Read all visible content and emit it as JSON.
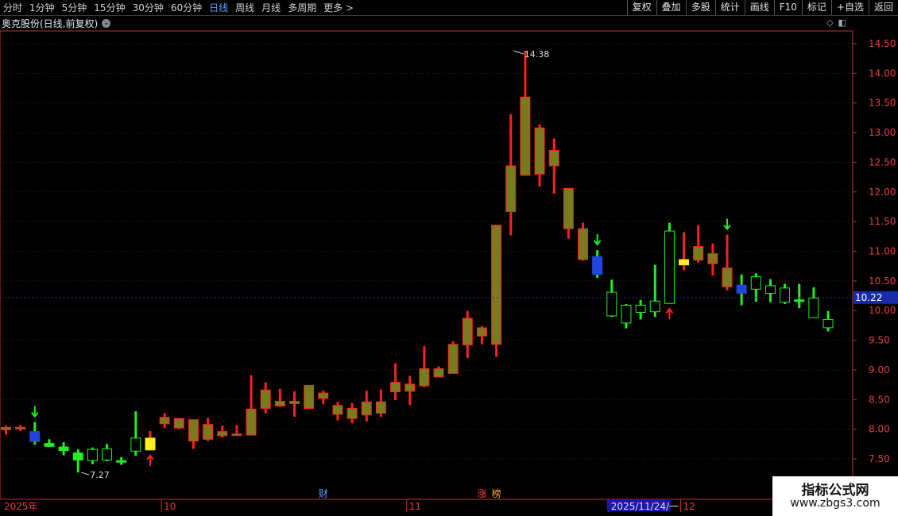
{
  "toolbar": {
    "periods": [
      "分时",
      "1分钟",
      "5分钟",
      "15分钟",
      "30分钟",
      "60分钟",
      "日线",
      "周线",
      "月线",
      "多周期",
      "更多 >"
    ],
    "active_period": "日线",
    "right_buttons": [
      "复权",
      "叠加",
      "多股",
      "统计",
      "画线",
      "F10",
      "标记",
      "+自选",
      "返回"
    ]
  },
  "title": "奥克股份(日线,前复权)",
  "colors": {
    "up": "#ff2020",
    "down": "#22ee22",
    "olive": "#7a7a1e",
    "blue": "#2244dd",
    "yellow": "#ffee22",
    "axis": "#c03030",
    "grid": "#5a1a1a"
  },
  "chart_data": {
    "type": "candlestick",
    "y_ticks": [
      "14.50",
      "14.00",
      "13.50",
      "13.00",
      "12.50",
      "12.00",
      "11.50",
      "11.00",
      "10.50",
      "10.00",
      "9.50",
      "9.00",
      "8.50",
      "8.00",
      "7.50"
    ],
    "ylim": [
      7.3,
      14.6
    ],
    "current_price": "10.22",
    "high_label": "14.38",
    "low_label": "7.27",
    "x_labels": [
      {
        "text": "2025年",
        "index": 0
      },
      {
        "text": "10",
        "index": 11
      },
      {
        "text": "11",
        "index": 28
      },
      {
        "text": "2025/11/24/一",
        "index": 42
      },
      {
        "text": "12",
        "index": 47
      }
    ],
    "event_tags": [
      {
        "text": "财",
        "index": 22,
        "color": "#5aa0ff"
      },
      {
        "text": "涨",
        "index": 33,
        "color": "#ff4040"
      },
      {
        "text": "榜",
        "index": 34,
        "color": "#ffaa40"
      }
    ],
    "candles": [
      {
        "o": 8.03,
        "h": 8.06,
        "l": 7.91,
        "c": 7.99,
        "k": "olive"
      },
      {
        "o": 8.01,
        "h": 8.07,
        "l": 7.97,
        "c": 8.03,
        "k": "olive"
      },
      {
        "o": 7.96,
        "h": 8.12,
        "l": 7.74,
        "c": 7.79,
        "k": "blue"
      },
      {
        "o": 7.76,
        "h": 7.83,
        "l": 7.7,
        "c": 7.71,
        "k": "down"
      },
      {
        "o": 7.7,
        "h": 7.78,
        "l": 7.56,
        "c": 7.64,
        "k": "down"
      },
      {
        "o": 7.6,
        "h": 7.66,
        "l": 7.27,
        "c": 7.48,
        "k": "down"
      },
      {
        "o": 7.47,
        "h": 7.69,
        "l": 7.41,
        "c": 7.66,
        "k": "downhollow"
      },
      {
        "o": 7.67,
        "h": 7.75,
        "l": 7.46,
        "c": 7.48,
        "k": "downhollow"
      },
      {
        "o": 7.47,
        "h": 7.53,
        "l": 7.4,
        "c": 7.46,
        "k": "down"
      },
      {
        "o": 7.63,
        "h": 8.3,
        "l": 7.55,
        "c": 7.85,
        "k": "downhollow"
      },
      {
        "o": 7.65,
        "h": 7.97,
        "l": 7.65,
        "c": 7.85,
        "k": "yellow"
      },
      {
        "o": 8.09,
        "h": 8.27,
        "l": 8.02,
        "c": 8.2,
        "k": "olive"
      },
      {
        "o": 8.18,
        "h": 8.19,
        "l": 8.0,
        "c": 8.02,
        "k": "olive"
      },
      {
        "o": 8.16,
        "h": 8.15,
        "l": 7.67,
        "c": 7.8,
        "k": "olive"
      },
      {
        "o": 7.83,
        "h": 8.19,
        "l": 7.8,
        "c": 8.08,
        "k": "olive"
      },
      {
        "o": 7.96,
        "h": 8.06,
        "l": 7.86,
        "c": 7.89,
        "k": "olive"
      },
      {
        "o": 7.92,
        "h": 8.07,
        "l": 7.9,
        "c": 7.91,
        "k": "olive"
      },
      {
        "o": 7.9,
        "h": 8.91,
        "l": 7.9,
        "c": 8.34,
        "k": "olive"
      },
      {
        "o": 8.35,
        "h": 8.79,
        "l": 8.27,
        "c": 8.66,
        "k": "olive"
      },
      {
        "o": 8.47,
        "h": 8.68,
        "l": 8.38,
        "c": 8.39,
        "k": "olive"
      },
      {
        "o": 8.47,
        "h": 8.64,
        "l": 8.21,
        "c": 8.43,
        "k": "olive"
      },
      {
        "o": 8.35,
        "h": 8.74,
        "l": 8.35,
        "c": 8.74,
        "k": "olive"
      },
      {
        "o": 8.61,
        "h": 8.65,
        "l": 8.42,
        "c": 8.52,
        "k": "olive"
      },
      {
        "o": 8.4,
        "h": 8.46,
        "l": 8.15,
        "c": 8.25,
        "k": "olive"
      },
      {
        "o": 8.35,
        "h": 8.44,
        "l": 8.1,
        "c": 8.18,
        "k": "olive"
      },
      {
        "o": 8.24,
        "h": 8.65,
        "l": 8.13,
        "c": 8.46,
        "k": "olive"
      },
      {
        "o": 8.27,
        "h": 8.67,
        "l": 8.21,
        "c": 8.46,
        "k": "olive"
      },
      {
        "o": 8.63,
        "h": 9.11,
        "l": 8.49,
        "c": 8.79,
        "k": "olive"
      },
      {
        "o": 8.76,
        "h": 8.9,
        "l": 8.41,
        "c": 8.64,
        "k": "olive"
      },
      {
        "o": 8.73,
        "h": 9.4,
        "l": 8.71,
        "c": 9.02,
        "k": "olive"
      },
      {
        "o": 8.88,
        "h": 9.06,
        "l": 8.88,
        "c": 9.02,
        "k": "olive"
      },
      {
        "o": 8.94,
        "h": 9.48,
        "l": 8.94,
        "c": 9.43,
        "k": "olive"
      },
      {
        "o": 9.87,
        "h": 9.99,
        "l": 9.2,
        "c": 9.42,
        "k": "olive"
      },
      {
        "o": 9.71,
        "h": 9.74,
        "l": 9.43,
        "c": 9.57,
        "k": "olive"
      },
      {
        "o": 9.43,
        "h": 11.44,
        "l": 9.22,
        "c": 11.44,
        "k": "olive"
      },
      {
        "o": 12.44,
        "h": 13.31,
        "l": 11.27,
        "c": 11.67,
        "k": "olive"
      },
      {
        "o": 13.6,
        "h": 14.38,
        "l": 12.65,
        "c": 12.28,
        "k": "olive"
      },
      {
        "o": 13.08,
        "h": 13.14,
        "l": 12.09,
        "c": 12.3,
        "k": "olive"
      },
      {
        "o": 12.7,
        "h": 12.9,
        "l": 11.97,
        "c": 12.44,
        "k": "olive"
      },
      {
        "o": 12.06,
        "h": 12.07,
        "l": 11.21,
        "c": 11.38,
        "k": "olive"
      },
      {
        "o": 11.38,
        "h": 11.48,
        "l": 10.84,
        "c": 10.86,
        "k": "olive"
      },
      {
        "o": 10.91,
        "h": 11.02,
        "l": 10.55,
        "c": 10.61,
        "k": "blue"
      },
      {
        "o": 10.31,
        "h": 10.52,
        "l": 9.89,
        "c": 9.91,
        "k": "downhollow"
      },
      {
        "o": 10.09,
        "h": 10.11,
        "l": 9.7,
        "c": 9.79,
        "k": "downhollow"
      },
      {
        "o": 10.09,
        "h": 10.18,
        "l": 9.85,
        "c": 9.97,
        "k": "downhollow"
      },
      {
        "o": 10.16,
        "h": 10.77,
        "l": 9.89,
        "c": 9.98,
        "k": "downhollow"
      },
      {
        "o": 11.34,
        "h": 11.48,
        "l": 10.12,
        "c": 10.12,
        "k": "downhollow"
      },
      {
        "o": 10.77,
        "h": 11.32,
        "l": 10.68,
        "c": 10.86,
        "k": "yellow"
      },
      {
        "o": 11.08,
        "h": 11.44,
        "l": 10.81,
        "c": 10.85,
        "k": "olive"
      },
      {
        "o": 10.96,
        "h": 11.13,
        "l": 10.59,
        "c": 10.79,
        "k": "olive"
      },
      {
        "o": 10.72,
        "h": 11.28,
        "l": 10.34,
        "c": 10.4,
        "k": "olive"
      },
      {
        "o": 10.43,
        "h": 10.61,
        "l": 10.09,
        "c": 10.29,
        "k": "blue"
      },
      {
        "o": 10.57,
        "h": 10.63,
        "l": 10.15,
        "c": 10.36,
        "k": "downhollow"
      },
      {
        "o": 10.42,
        "h": 10.53,
        "l": 10.14,
        "c": 10.29,
        "k": "downhollow"
      },
      {
        "o": 10.38,
        "h": 10.45,
        "l": 10.11,
        "c": 10.14,
        "k": "downhollow"
      },
      {
        "o": 10.16,
        "h": 10.45,
        "l": 10.04,
        "c": 10.18,
        "k": "down"
      },
      {
        "o": 10.21,
        "h": 10.39,
        "l": 9.88,
        "c": 9.88,
        "k": "downhollow"
      },
      {
        "o": 9.85,
        "h": 9.99,
        "l": 9.65,
        "c": 9.71,
        "k": "downhollow"
      }
    ],
    "down_arrows": [
      2,
      41,
      50
    ],
    "up_arrows": [
      10,
      46
    ]
  },
  "watermark": {
    "line1": "指标公式网",
    "line2": "www.zbgs3.com"
  }
}
